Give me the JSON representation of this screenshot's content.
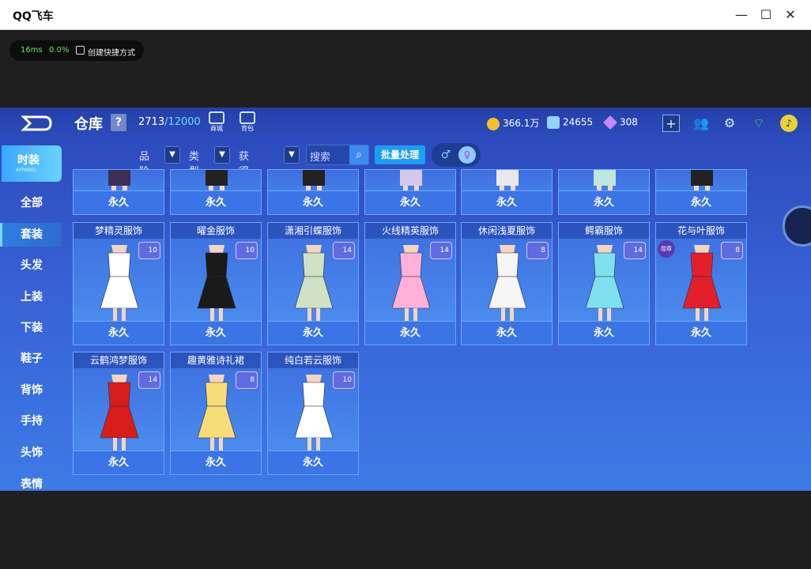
{
  "window": {
    "title": "QQ飞车"
  },
  "perf": {
    "latency": "16ms",
    "loss": "0.0%",
    "shortcut": "创建快捷方式"
  },
  "header": {
    "title": "仓库",
    "help": "?",
    "count": "2713",
    "max": "/12000",
    "shop_label": "商城",
    "bag_label": "背包"
  },
  "currency": {
    "coins": "366.1万",
    "points": "24655",
    "diamonds": "308"
  },
  "sidebar": {
    "active_top": "时装",
    "active_top_sub": "APPAREL",
    "items": [
      "全部",
      "套装",
      "头发",
      "上装",
      "下装",
      "鞋子",
      "背饰",
      "手持",
      "头饰",
      "表情"
    ]
  },
  "filters": {
    "f1": "品阶",
    "f2": "类型",
    "f3": "获得时间",
    "search_placeholder": "搜索",
    "batch": "批量处理"
  },
  "items": {
    "permanent": "永久",
    "row2": [
      {
        "name": "梦精灵服饰",
        "lvl": "10",
        "color": "#ffffff"
      },
      {
        "name": "曜金服饰",
        "lvl": "10",
        "color": "#1a1a1a"
      },
      {
        "name": "潇湘引蝶服饰",
        "lvl": "14",
        "color": "#cfe3c4"
      },
      {
        "name": "火线精英服饰",
        "lvl": "14",
        "color": "#ffb0d8"
      },
      {
        "name": "休闲浅夏服饰",
        "lvl": "8",
        "color": "#f5f5f5"
      },
      {
        "name": "鳄霸服饰",
        "lvl": "14",
        "color": "#7fe0f0"
      },
      {
        "name": "花与叶服饰",
        "lvl": "8",
        "color": "#e21f2a",
        "badge": "勋章"
      }
    ],
    "row3": [
      {
        "name": "云鹤鸿梦服饰",
        "lvl": "14",
        "color": "#d81c1c"
      },
      {
        "name": "趣黄雅诗礼裙",
        "lvl": "8",
        "color": "#f7dc7a"
      },
      {
        "name": "纯白若云服饰",
        "lvl": "10",
        "color": "#ffffff"
      }
    ]
  }
}
